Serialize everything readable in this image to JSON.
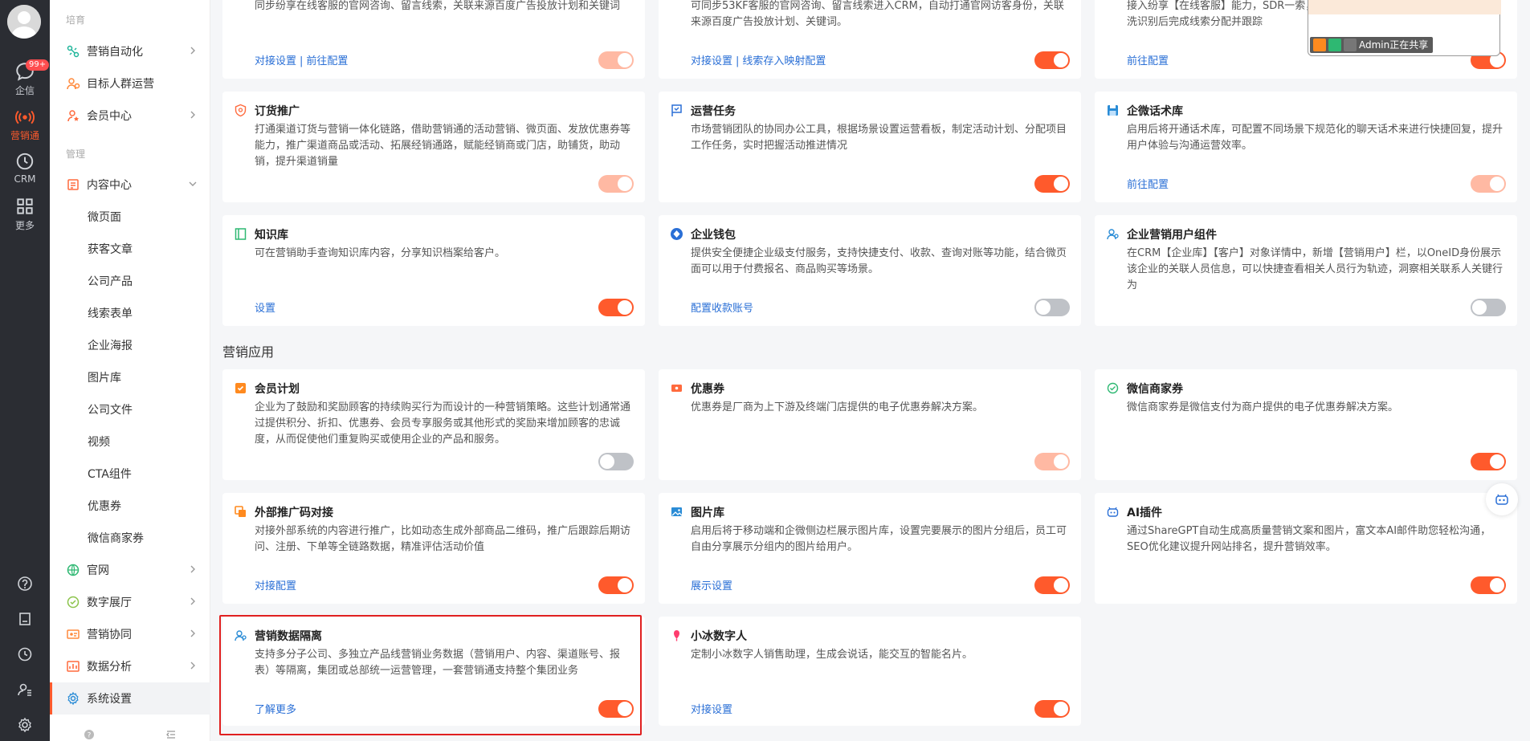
{
  "rail": {
    "items": [
      {
        "label": "企信",
        "badge": "99+"
      },
      {
        "label": "营销通"
      },
      {
        "label": "CRM"
      },
      {
        "label": "更多"
      }
    ]
  },
  "menu": {
    "group1": "培育",
    "group2": "管理",
    "items_top": [
      "营销自动化",
      "目标人群运营",
      "会员中心"
    ],
    "content_center": "内容中心",
    "sub_items": [
      "微页面",
      "获客文章",
      "公司产品",
      "线索表单",
      "企业海报",
      "图片库",
      "公司文件",
      "视频",
      "CTA组件",
      "优惠券",
      "微信商家券"
    ],
    "items_bottom": [
      "官网",
      "数字展厅",
      "营销协同",
      "数据分析",
      "系统设置"
    ]
  },
  "content": {
    "section_marketing_apps": "营销应用",
    "top_row": [
      {
        "desc": "同步纷享在线客服的官网咨询、留言线索，关联来源百度广告投放计划和关键词",
        "links": [
          "对接设置",
          "前往配置"
        ]
      },
      {
        "desc": "可同步53KF客服的官网咨询、留言线索进入CRM，自动打通官网访客身份，关联来源百度广告投放计划、关键词。",
        "links": [
          "对接设置",
          "线索存入映射配置"
        ]
      },
      {
        "desc": "接入纷享【在线客服】能力，SDR一索，清洗识别后完成线索分配并跟踪",
        "links": [
          "前往配置"
        ]
      }
    ],
    "cards": [
      {
        "title": "订货推广",
        "desc": "打通渠道订货与营销一体化链路，借助营销通的活动营销、微页面、发放优惠券等能力，推广渠道商品或活动、拓展经销通路，赋能经销商或门店，助铺货，助动销，提升渠道销量",
        "links": []
      },
      {
        "title": "运营任务",
        "desc": "市场营销团队的协同办公工具，根据场景设置运营看板，制定活动计划、分配项目工作任务，实时把握活动推进情况",
        "links": []
      },
      {
        "title": "企微话术库",
        "desc": "启用后将开通话术库，可配置不同场景下规范化的聊天话术来进行快捷回复，提升用户体验与沟通运营效率。",
        "links": [
          "前往配置"
        ]
      },
      {
        "title": "知识库",
        "desc": "可在营销助手查询知识库内容，分享知识档案给客户。",
        "links": [
          "设置"
        ]
      },
      {
        "title": "企业钱包",
        "desc": "提供安全便捷企业级支付服务，支持快捷支付、收款、查询对账等功能，结合微页面可以用于付费报名、商品购买等场景。",
        "links": [
          "配置收款账号"
        ]
      },
      {
        "title": "企业营销用户组件",
        "desc": "在CRM【企业库】【客户】对象详情中，新增【营销用户】栏，以OneID身份展示该企业的关联人员信息，可以快捷查看相关人员行为轨迹，洞察相关联系人关键行为",
        "links": []
      },
      {
        "title": "会员计划",
        "desc": "企业为了鼓励和奖励顾客的持续购买行为而设计的一种营销策略。这些计划通常通过提供积分、折扣、优惠券、会员专享服务或其他形式的奖励来增加顾客的忠诚度，从而促使他们重复购买或使用企业的产品和服务。",
        "links": []
      },
      {
        "title": "优惠券",
        "desc": "优惠券是厂商为上下游及终端门店提供的电子优惠券解决方案。",
        "links": []
      },
      {
        "title": "微信商家券",
        "desc": "微信商家券是微信支付为商户提供的电子优惠券解决方案。",
        "links": []
      },
      {
        "title": "外部推广码对接",
        "desc": "对接外部系统的内容进行推广，比如动态生成外部商品二维码，推广后跟踪后期访问、注册、下单等全链路数据，精准评估活动价值",
        "links": [
          "对接配置"
        ]
      },
      {
        "title": "图片库",
        "desc": "启用后将于移动端和企微侧边栏展示图片库，设置完要展示的图片分组后，员工可自由分享展示分组内的图片给用户。",
        "links": [
          "展示设置"
        ]
      },
      {
        "title": "AI插件",
        "desc": "通过ShareGPT自动生成高质量营销文案和图片，富文本AI邮件助您轻松沟通，SEO优化建议提升网站排名，提升营销效率。",
        "links": []
      },
      {
        "title": "营销数据隔离",
        "desc": "支持多分子公司、多独立产品线营销业务数据（营销用户、内容、渠道账号、报表）等隔离，集团或总部统一运营管理，一套营销通支持整个集团业务",
        "links": [
          "了解更多"
        ]
      },
      {
        "title": "小冰数字人",
        "desc": "定制小冰数字人销售助理，生成会说话，能交互的智能名片。",
        "links": [
          "对接设置"
        ]
      }
    ]
  },
  "share": {
    "label": "Admin正在共享"
  },
  "colors": {
    "accent": "#ff5a2c",
    "link": "#2a6fd6",
    "toggle_off": "#bfc2c7",
    "highlight": "#e02020"
  }
}
